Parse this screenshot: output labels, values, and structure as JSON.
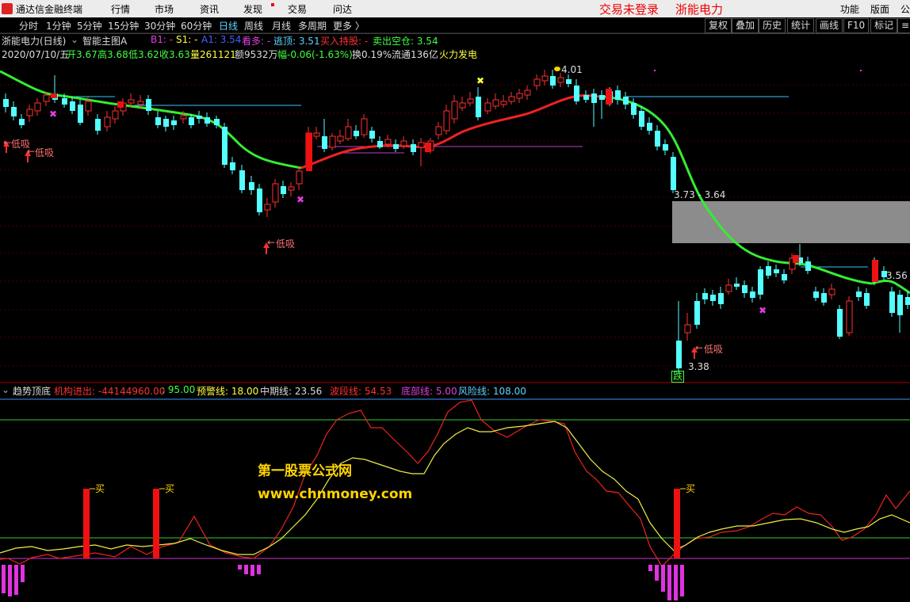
{
  "menu": {
    "app_name": "通达信金融终端",
    "items": [
      "行情",
      "市场",
      "资讯",
      "发现",
      "交易",
      "问达"
    ],
    "status_login": "交易未登录",
    "status_stock": "浙能电力",
    "right_items": [
      "功能",
      "版面",
      "公"
    ]
  },
  "periods": [
    "分时",
    "1分钟",
    "5分钟",
    "15分钟",
    "30分钟",
    "60分钟",
    "日线",
    "周线",
    "月线",
    "多周期",
    "更多 〉"
  ],
  "active_period": "日线",
  "toolbar_buttons": [
    "复权",
    "叠加",
    "历史",
    "统计",
    "画线",
    "F10",
    "标记",
    "≡"
  ],
  "main_header": {
    "title": "浙能电力(日线)",
    "indicator": "智能主图A",
    "b1": "B1: -",
    "s1": "S1: -",
    "a1": "A1: 3.54",
    "kanduo": "看多: -",
    "taoding": "逃顶: 3.51",
    "mairu": "买入持股: -",
    "maichu": "卖出空仓: 3.54"
  },
  "quote": {
    "date": "2020/07/10/五",
    "open": "开3.67",
    "high": "高3.68",
    "low": "低3.62",
    "close": "收3.63",
    "volume": "量261121",
    "amount": "额9532万",
    "change": "幅-0.06(-1.63%)",
    "turnover": "换0.19%",
    "float": "流通136亿",
    "concept": "火力发电"
  },
  "sub_header": {
    "name": "趋势顶底",
    "jigou": "机构进出: -44144960.00",
    "colon_val": ": 95.00",
    "yujing": "预警线: 18.00",
    "zhongqi": "中期线: 23.56",
    "boduan": "波段线: 54.53",
    "dibu": "底部线: 5.00",
    "fengxian": "风险线: 108.00"
  },
  "annotations": {
    "dixi_label": "低吸",
    "price_401": "4.01",
    "price_373": "3.73 - 3.64",
    "price_356": "3.56",
    "price_338": "3.38",
    "die": "跌",
    "mai": "买"
  },
  "watermark": {
    "line1": "第一股票公式网",
    "line2": "www.chnmoney.com"
  },
  "chart_data": {
    "type": "candlestick",
    "series_candles": [
      {
        "o": 122,
        "c": 132,
        "h": 118,
        "l": 140
      },
      {
        "o": 135,
        "c": 145,
        "h": 128,
        "l": 150
      },
      {
        "o": 150,
        "c": 158,
        "h": 144,
        "l": 162
      },
      {
        "o": 148,
        "c": 138,
        "h": 132,
        "l": 154
      },
      {
        "o": 140,
        "c": 130,
        "h": 124,
        "l": 146
      },
      {
        "o": 128,
        "c": 122,
        "h": 116,
        "l": 134
      },
      {
        "o": 118,
        "c": 126,
        "h": 95,
        "l": 130
      },
      {
        "o": 124,
        "c": 132,
        "h": 118,
        "l": 136
      },
      {
        "o": 128,
        "c": 140,
        "h": 122,
        "l": 144
      },
      {
        "o": 132,
        "c": 155,
        "h": 126,
        "l": 158
      },
      {
        "o": 140,
        "c": 128,
        "h": 122,
        "l": 146
      },
      {
        "o": 150,
        "c": 165,
        "h": 144,
        "l": 170
      },
      {
        "o": 160,
        "c": 148,
        "h": 140,
        "l": 166
      },
      {
        "o": 150,
        "c": 140,
        "h": 134,
        "l": 156
      },
      {
        "o": 140,
        "c": 130,
        "h": 124,
        "l": 146
      },
      {
        "o": 130,
        "c": 126,
        "h": 118,
        "l": 136
      },
      {
        "o": 132,
        "c": 128,
        "h": 120,
        "l": 138
      },
      {
        "o": 125,
        "c": 140,
        "h": 120,
        "l": 145
      }
    ]
  }
}
